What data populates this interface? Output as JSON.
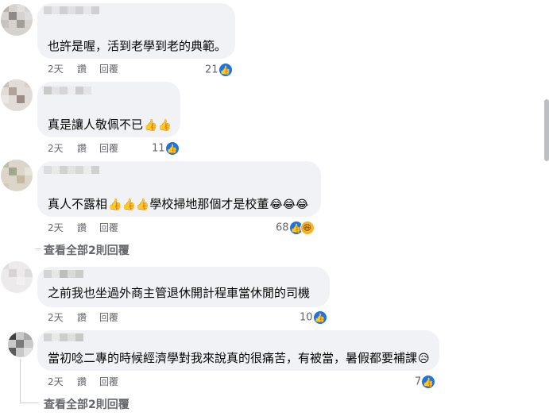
{
  "comments": [
    {
      "text": "也許是喔，活到老學到老的典範。",
      "emoji": "",
      "time": "2天",
      "translate": "讚",
      "reply": "回覆",
      "reaction_count": "21"
    },
    {
      "text": "真是讓人敬佩不已",
      "emoji": "👍👍",
      "time": "2天",
      "translate": "讚",
      "reply": "回覆",
      "reaction_count": "11"
    },
    {
      "text": "真人不露相",
      "emoji": "👍👍👍",
      "text2": "學校掃地那個才是校董",
      "emoji2": "😂😂😂",
      "time": "2天",
      "translate": "讚",
      "reply": "回覆",
      "reaction_count": "68"
    },
    {
      "text": "之前我也坐過外商主管退休開計程車當休閒的司機",
      "emoji": "",
      "time": "2天",
      "translate": "讚",
      "reply": "回覆",
      "reaction_count": "10"
    },
    {
      "text": "當初唸二專的時候經濟學對我來說真的很痛苦，有被當，暑假都要補課",
      "emoji": "😥",
      "time": "2天",
      "translate": "讚",
      "reply": "回覆",
      "reaction_count": "7"
    }
  ],
  "view_replies": [
    "查看全部2則回覆",
    "查看全部2則回覆"
  ],
  "icons": {
    "like": "like-icon",
    "haha": "haha-icon"
  },
  "colors": {
    "bubble": "#f0f2f5",
    "like_blue": "#1b74e4",
    "meta": "#65676b"
  }
}
